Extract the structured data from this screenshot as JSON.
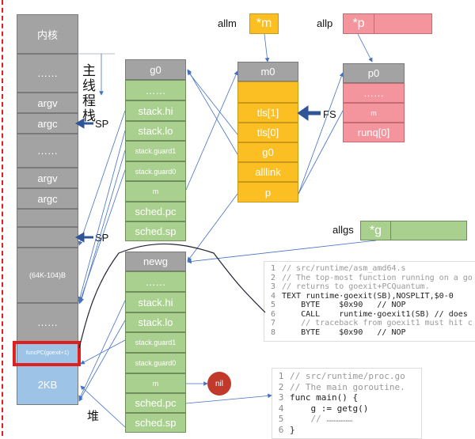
{
  "main_stack": [
    "内核",
    "……",
    "argv",
    "argc",
    "……",
    "argv",
    "argc",
    "",
    "",
    "(64K-104)B",
    "……",
    "funcPC(goexit+1)",
    "2KB"
  ],
  "main_stack_label": "主线程栈",
  "heap_label": "堆",
  "sp_label": "SP",
  "g0": [
    "g0",
    "……",
    "stack.hi",
    "stack.lo",
    "stack.guard1",
    "stack.guard0",
    "m",
    "sched.pc",
    "sched.sp"
  ],
  "newg": [
    "newg",
    "……",
    "stack.hi",
    "stack.lo",
    "stack.guard1",
    "stack.guard0",
    "m",
    "sched.pc",
    "sched.sp"
  ],
  "m0": [
    "m0",
    "",
    "tls[1]",
    "tls[0]",
    "g0",
    "alllink",
    "p"
  ],
  "p0": [
    "p0",
    "……",
    "m",
    "runq[0]"
  ],
  "allm": {
    "label": "allm",
    "value": "*m"
  },
  "allp": {
    "label": "allp",
    "value": "*p"
  },
  "allgs": {
    "label": "allgs",
    "value": "*g"
  },
  "fs_label": "FS",
  "nil_label": "nil",
  "highlight_color": "#e02020",
  "code1": [
    "// src/runtime/asm_amd64.s",
    "// The top-most function running on a go",
    "// returns to goexit+PCQuantum.",
    "TEXT runtime·goexit(SB),NOSPLIT,$0-0",
    "    BYTE    $0x90   // NOP",
    "    CALL    runtime·goexit1(SB) // does",
    "    // traceback from goexit1 must hit c",
    "    BYTE    $0x90   // NOP"
  ],
  "code2": [
    "// src/runtime/proc.go",
    "// The main goroutine.",
    "func main() {",
    "    g := getg()",
    "    // ……………",
    "}"
  ]
}
